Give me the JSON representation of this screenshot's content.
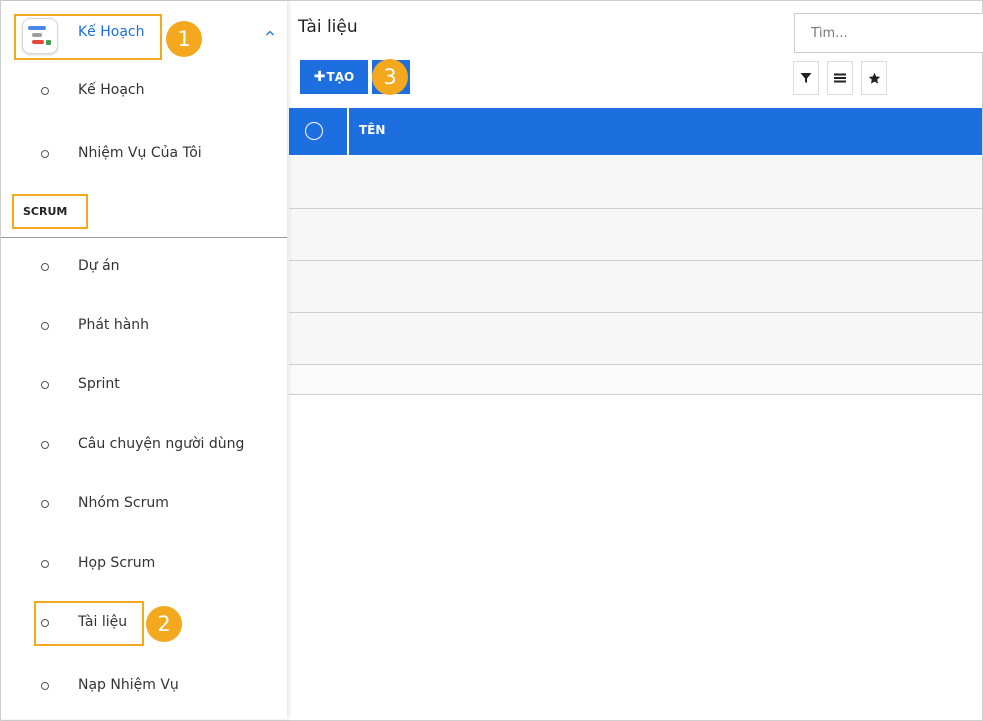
{
  "sidebar": {
    "app_title": "Kế Hoạch",
    "app_items": [
      {
        "label": "Kế Hoạch"
      },
      {
        "label": "Nhiệm Vụ Của Tôi"
      }
    ],
    "section_label": "SCRUM",
    "scrum_items": [
      {
        "label": "Dự án"
      },
      {
        "label": "Phát hành"
      },
      {
        "label": "Sprint"
      },
      {
        "label": "Câu chuyện người dùng"
      },
      {
        "label": "Nhóm Scrum"
      },
      {
        "label": "Họp Scrum"
      },
      {
        "label": "Tài liệu"
      },
      {
        "label": "Nạp Nhiệm Vụ"
      }
    ]
  },
  "main": {
    "title": "Tài liệu",
    "search_placeholder": "Tìm...",
    "create_label": "TẠO",
    "table": {
      "columns": [
        "TÊN"
      ]
    }
  },
  "badges": [
    "1",
    "2",
    "3"
  ],
  "colors": {
    "accent": "#1d6fe0",
    "highlight": "#f3a81d"
  },
  "icons": [
    "planning-app-icon",
    "chevron-up-icon",
    "filter-icon",
    "list-icon",
    "star-icon",
    "plus-icon"
  ]
}
